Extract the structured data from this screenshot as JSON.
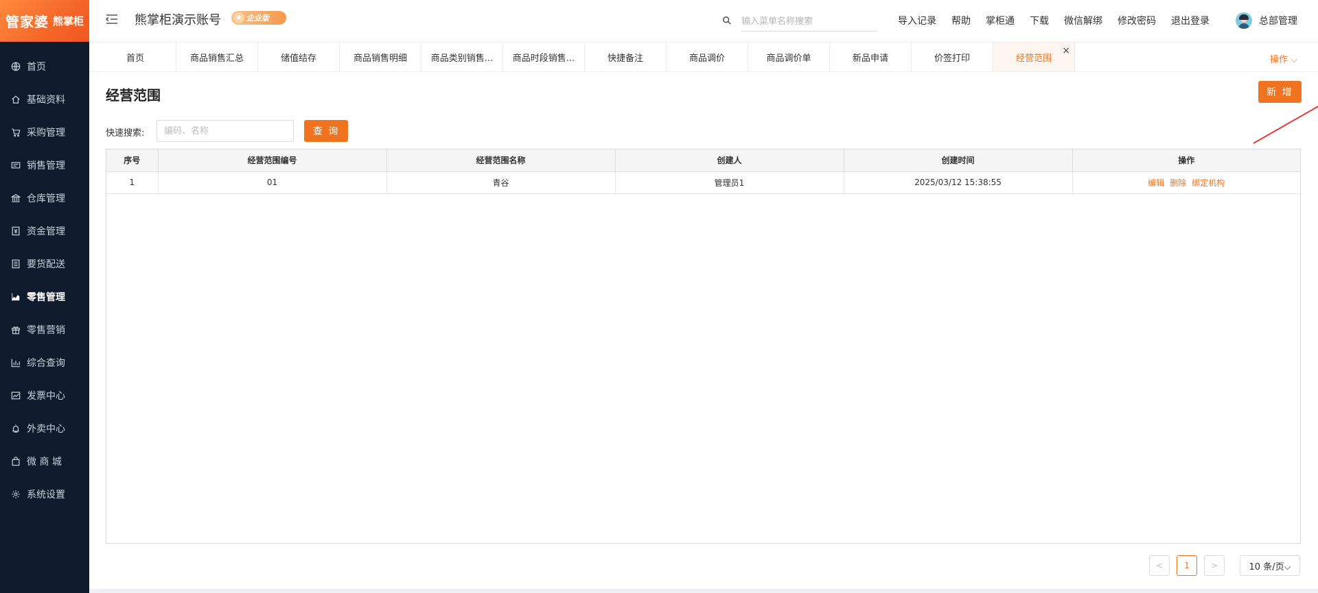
{
  "brand": {
    "name": "管家婆",
    "sub": "熊掌柜"
  },
  "sidebar": {
    "items": [
      {
        "label": "首页",
        "icon": "globe-icon"
      },
      {
        "label": "基础资料",
        "icon": "home-icon"
      },
      {
        "label": "采购管理",
        "icon": "cart-icon"
      },
      {
        "label": "销售管理",
        "icon": "ticket-icon"
      },
      {
        "label": "仓库管理",
        "icon": "bank-icon"
      },
      {
        "label": "资金管理",
        "icon": "money-icon"
      },
      {
        "label": "要货配送",
        "icon": "list-icon"
      },
      {
        "label": "零售管理",
        "icon": "area-chart-icon"
      },
      {
        "label": "零售营销",
        "icon": "gift-icon"
      },
      {
        "label": "综合查询",
        "icon": "bar-chart-icon"
      },
      {
        "label": "发票中心",
        "icon": "line-chart-icon"
      },
      {
        "label": "外卖中心",
        "icon": "alarm-icon"
      },
      {
        "label": "微 商 城",
        "icon": "bag-icon"
      },
      {
        "label": "系统设置",
        "icon": "gear-icon"
      }
    ],
    "active_index": 7
  },
  "header": {
    "title": "熊掌柜演示账号",
    "badge": "企业版",
    "search_placeholder": "输入菜单名称搜索",
    "links": [
      "导入记录",
      "帮助",
      "掌柜通",
      "下载",
      "微信解绑",
      "修改密码",
      "退出登录"
    ],
    "user": "总部管理"
  },
  "tabs": {
    "items": [
      "首页",
      "商品销售汇总",
      "储值结存",
      "商品销售明细",
      "商品类别销售...",
      "商品时段销售...",
      "快捷备注",
      "商品调价",
      "商品调价单",
      "新品申请",
      "价签打印",
      "经营范围"
    ],
    "active_index": 11,
    "ops_label": "操作 ⌵"
  },
  "page": {
    "title": "经营范围",
    "add_label": "新 增",
    "quick_search_label": "快速搜索:",
    "quick_search_placeholder": "编码、名称",
    "query_label": "查 询"
  },
  "table": {
    "columns": [
      "序号",
      "经营范围编号",
      "经营范围名称",
      "创建人",
      "创建时间",
      "操作"
    ],
    "rows": [
      {
        "no": "1",
        "code": "01",
        "name": "青谷",
        "creator": "管理员1",
        "time": "2025/03/12 15:38:55"
      }
    ],
    "actions": [
      "编辑",
      "删除",
      "绑定机构"
    ]
  },
  "pagination": {
    "prev": "<",
    "current": "1",
    "next": ">",
    "page_size": "10 条/页⌵"
  },
  "colors": {
    "accent": "#f07420",
    "sidebar_bg": "#0f1a2c"
  }
}
